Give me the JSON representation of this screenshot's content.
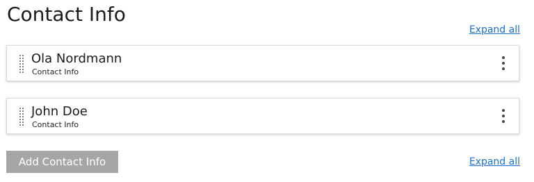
{
  "header": {
    "title": "Contact Info",
    "expand_all_top": "Expand all"
  },
  "contacts": [
    {
      "name": "Ola Nordmann",
      "subtitle": "Contact Info"
    },
    {
      "name": "John Doe",
      "subtitle": "Contact Info"
    }
  ],
  "footer": {
    "add_button_label": "Add Contact Info",
    "expand_all_bottom": "Expand all"
  },
  "colors": {
    "link": "#1b6fcf",
    "button_bg": "#a6a6a6",
    "button_text": "#ffffff",
    "card_border": "#dcdcdc"
  },
  "icons": {
    "drag_handle": "drag-handle-icon",
    "more_menu": "more-vertical-icon"
  }
}
